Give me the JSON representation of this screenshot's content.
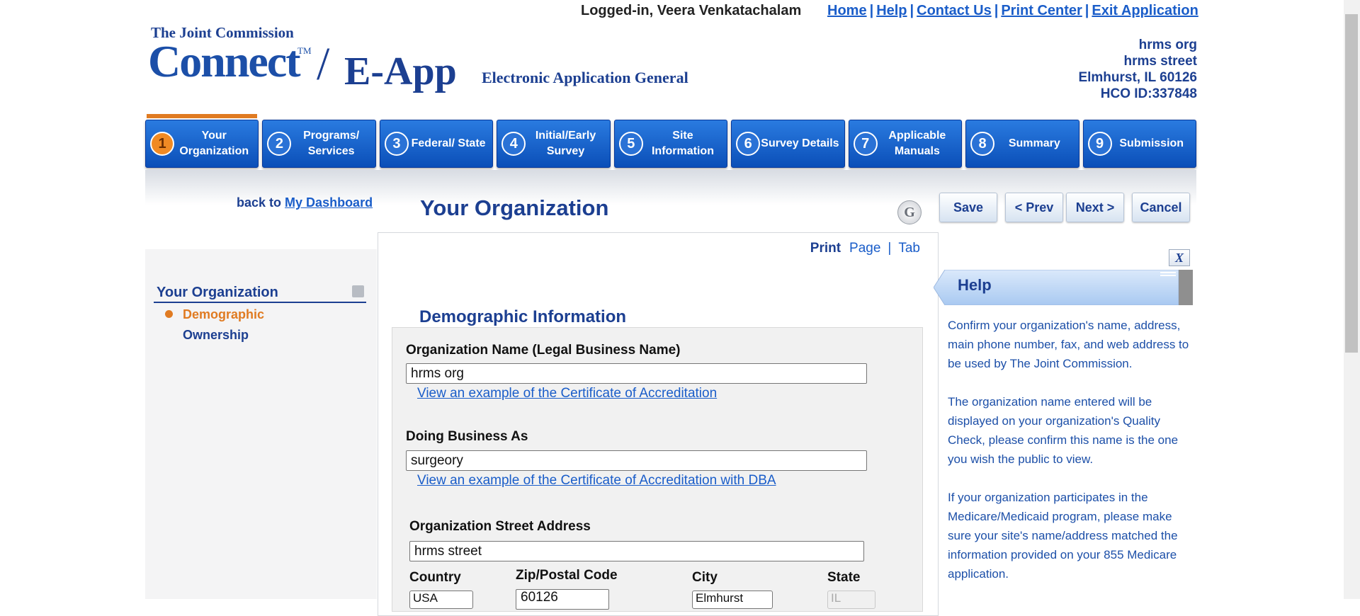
{
  "header": {
    "logged_in": "Logged-in, Veera Venkatachalam",
    "links": [
      "Home",
      "Help",
      "Contact Us",
      "Print Center",
      "Exit Application"
    ],
    "separator": "|",
    "logo": {
      "org": "The Joint Commission",
      "connect": "Connect",
      "tm": "TM",
      "slash": "/",
      "product": "E-App",
      "subtitle": "Electronic Application General"
    },
    "org_info": {
      "name": "hrms org",
      "street": "hrms street",
      "city_state_zip": "Elmhurst, IL 60126",
      "hco_id": "HCO ID:337848"
    }
  },
  "steps": [
    {
      "num": "1",
      "label": "Your Organization"
    },
    {
      "num": "2",
      "label": "Programs/ Services"
    },
    {
      "num": "3",
      "label": "Federal/ State"
    },
    {
      "num": "4",
      "label": "Initial/Early Survey"
    },
    {
      "num": "5",
      "label": "Site Information"
    },
    {
      "num": "6",
      "label": "Survey Details"
    },
    {
      "num": "7",
      "label": "Applicable Manuals"
    },
    {
      "num": "8",
      "label": "Summary"
    },
    {
      "num": "9",
      "label": "Submission"
    }
  ],
  "active_step": 1,
  "back": {
    "prefix": "back to",
    "link": "My Dashboard"
  },
  "page_title": "Your Organization",
  "g_icon": "G",
  "buttons": {
    "save": "Save",
    "prev": "< Prev",
    "next": "Next >",
    "cancel": "Cancel"
  },
  "leftnav": {
    "title": "Your Organization",
    "items": [
      {
        "label": "Demographic",
        "active": true
      },
      {
        "label": "Ownership",
        "active": false
      }
    ]
  },
  "print_links": {
    "label": "Print",
    "page": "Page",
    "sep": "|",
    "tab": "Tab"
  },
  "form": {
    "section_title": "Demographic Information",
    "org_name_label": "Organization Name (Legal Business Name)",
    "org_name_value": "hrms org",
    "org_name_link": "View an example of the Certificate of Accreditation",
    "dba_label": "Doing Business As",
    "dba_value": "surgeory",
    "dba_link": "View an example of the Certificate of Accreditation with DBA",
    "street_label": "Organization Street Address",
    "street_value": "hrms street",
    "country_label": "Country",
    "country_value": "USA",
    "zip_label": "Zip/Postal Code",
    "zip_value": "60126",
    "city_label": "City",
    "city_value": "Elmhurst",
    "state_label": "State",
    "state_value": "IL"
  },
  "help": {
    "close": "X",
    "title": "Help",
    "paragraphs": [
      "Confirm your organization's name, address, main phone number, fax, and web address to be used by The Joint Commission.",
      "The organization name entered will be displayed on your organization's Quality Check, please confirm this name is the one you wish the public to view.",
      "If your organization participates in the Medicare/Medicaid program, please make sure your site's name/address matched the information provided on your 855 Medicare application."
    ]
  },
  "colors": {
    "brand_blue": "#1c3f91",
    "link_blue": "#1a5dc9",
    "step_blue": "#0b4fb8",
    "active_orange": "#e07b22"
  }
}
